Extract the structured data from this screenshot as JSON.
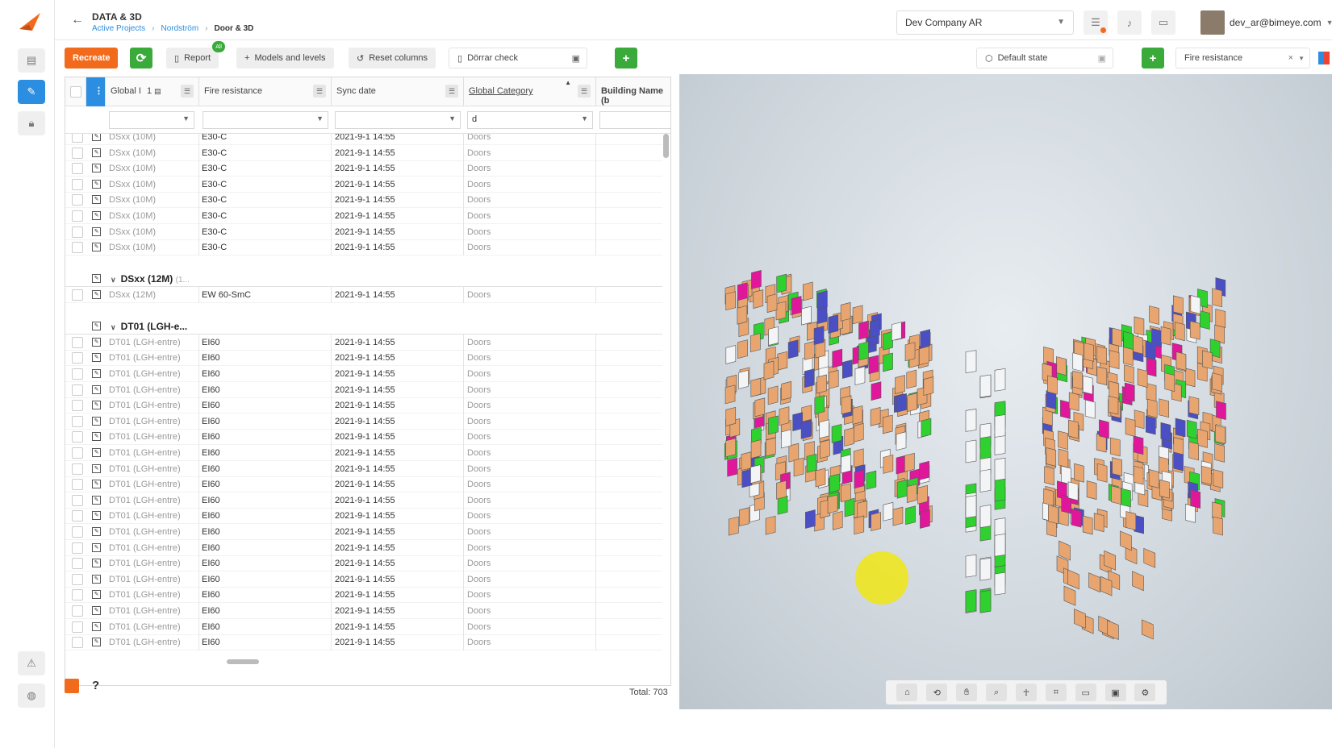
{
  "header": {
    "app_title": "DATA & 3D",
    "breadcrumbs": [
      "Active Projects",
      "Nordström",
      "Door & 3D"
    ],
    "company": "Dev Company AR",
    "user_email": "dev_ar@bimeye.com"
  },
  "toolbar": {
    "recreate": "Recreate",
    "report": "Report",
    "report_badge": "All",
    "models_levels": "Models and levels",
    "reset_columns": "Reset columns",
    "saved_view": "Dörrar check",
    "state": "Default state",
    "color_by": "Fire resistance"
  },
  "grid": {
    "columns": [
      "Global I",
      "Fire resistance",
      "Sync date",
      "Global Category",
      "Building Name (b"
    ],
    "sort_indicator": "1",
    "category_filter_value": "d",
    "total": "Total: 703",
    "groups": [
      {
        "title": "",
        "subtitle": "",
        "rows": [
          {
            "name": "DSxx (10M)",
            "fire": "E30-C",
            "sync": "2021-9-1 14:55",
            "cat": "Doors"
          },
          {
            "name": "DSxx (10M)",
            "fire": "E30-C",
            "sync": "2021-9-1 14:55",
            "cat": "Doors"
          },
          {
            "name": "DSxx (10M)",
            "fire": "E30-C",
            "sync": "2021-9-1 14:55",
            "cat": "Doors"
          },
          {
            "name": "DSxx (10M)",
            "fire": "E30-C",
            "sync": "2021-9-1 14:55",
            "cat": "Doors"
          },
          {
            "name": "DSxx (10M)",
            "fire": "E30-C",
            "sync": "2021-9-1 14:55",
            "cat": "Doors"
          },
          {
            "name": "DSxx (10M)",
            "fire": "E30-C",
            "sync": "2021-9-1 14:55",
            "cat": "Doors"
          },
          {
            "name": "DSxx (10M)",
            "fire": "E30-C",
            "sync": "2021-9-1 14:55",
            "cat": "Doors"
          },
          {
            "name": "DSxx (10M)",
            "fire": "E30-C",
            "sync": "2021-9-1 14:55",
            "cat": "Doors"
          }
        ]
      },
      {
        "title": "DSxx (12M)",
        "subtitle": "(1...",
        "rows": [
          {
            "name": "DSxx (12M)",
            "fire": "EW 60-SmC",
            "sync": "2021-9-1 14:55",
            "cat": "Doors"
          }
        ]
      },
      {
        "title": "DT01 (LGH-e...",
        "subtitle": "",
        "rows": [
          {
            "name": "DT01 (LGH-entre)",
            "fire": "EI60",
            "sync": "2021-9-1 14:55",
            "cat": "Doors"
          },
          {
            "name": "DT01 (LGH-entre)",
            "fire": "EI60",
            "sync": "2021-9-1 14:55",
            "cat": "Doors"
          },
          {
            "name": "DT01 (LGH-entre)",
            "fire": "EI60",
            "sync": "2021-9-1 14:55",
            "cat": "Doors"
          },
          {
            "name": "DT01 (LGH-entre)",
            "fire": "EI60",
            "sync": "2021-9-1 14:55",
            "cat": "Doors"
          },
          {
            "name": "DT01 (LGH-entre)",
            "fire": "EI60",
            "sync": "2021-9-1 14:55",
            "cat": "Doors"
          },
          {
            "name": "DT01 (LGH-entre)",
            "fire": "EI60",
            "sync": "2021-9-1 14:55",
            "cat": "Doors"
          },
          {
            "name": "DT01 (LGH-entre)",
            "fire": "EI60",
            "sync": "2021-9-1 14:55",
            "cat": "Doors"
          },
          {
            "name": "DT01 (LGH-entre)",
            "fire": "EI60",
            "sync": "2021-9-1 14:55",
            "cat": "Doors"
          },
          {
            "name": "DT01 (LGH-entre)",
            "fire": "EI60",
            "sync": "2021-9-1 14:55",
            "cat": "Doors"
          },
          {
            "name": "DT01 (LGH-entre)",
            "fire": "EI60",
            "sync": "2021-9-1 14:55",
            "cat": "Doors"
          },
          {
            "name": "DT01 (LGH-entre)",
            "fire": "EI60",
            "sync": "2021-9-1 14:55",
            "cat": "Doors"
          },
          {
            "name": "DT01 (LGH-entre)",
            "fire": "EI60",
            "sync": "2021-9-1 14:55",
            "cat": "Doors"
          },
          {
            "name": "DT01 (LGH-entre)",
            "fire": "EI60",
            "sync": "2021-9-1 14:55",
            "cat": "Doors"
          },
          {
            "name": "DT01 (LGH-entre)",
            "fire": "EI60",
            "sync": "2021-9-1 14:55",
            "cat": "Doors"
          },
          {
            "name": "DT01 (LGH-entre)",
            "fire": "EI60",
            "sync": "2021-9-1 14:55",
            "cat": "Doors"
          },
          {
            "name": "DT01 (LGH-entre)",
            "fire": "EI60",
            "sync": "2021-9-1 14:55",
            "cat": "Doors"
          },
          {
            "name": "DT01 (LGH-entre)",
            "fire": "EI60",
            "sync": "2021-9-1 14:55",
            "cat": "Doors"
          },
          {
            "name": "DT01 (LGH-entre)",
            "fire": "EI60",
            "sync": "2021-9-1 14:55",
            "cat": "Doors"
          },
          {
            "name": "DT01 (LGH-entre)",
            "fire": "EI60",
            "sync": "2021-9-1 14:55",
            "cat": "Doors"
          },
          {
            "name": "DT01 (LGH-entre)",
            "fire": "EI60",
            "sync": "2021-9-1 14:55",
            "cat": "Doors"
          }
        ]
      }
    ]
  },
  "viewer": {
    "colors": {
      "orange": "#e8a56f",
      "magenta": "#e0179b",
      "green": "#2fd12f",
      "blue": "#4b4fc4",
      "white": "#f2f4f6"
    },
    "toolbar_icons": [
      "home-icon",
      "orbit-icon",
      "pan-hand-icon",
      "zoom-icon",
      "walk-icon",
      "section-icon",
      "explode-icon",
      "model-browser-icon",
      "settings-icon"
    ]
  },
  "colors": {
    "accent": "#f26a1b",
    "primary": "#2b8ee0",
    "success": "#3aab3a"
  }
}
